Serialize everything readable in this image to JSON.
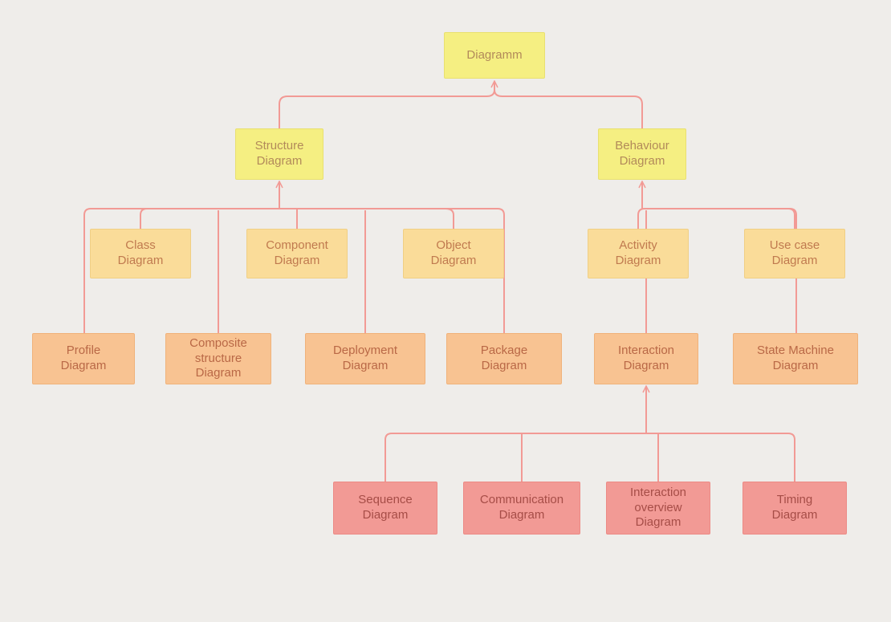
{
  "root": {
    "label": "Diagramm"
  },
  "categories": {
    "structure": {
      "label": "Structure\nDiagram"
    },
    "behaviour": {
      "label": "Behaviour\nDiagram"
    }
  },
  "structure_sub1": {
    "class": {
      "label": "Class\nDiagram"
    },
    "component": {
      "label": "Component\nDiagram"
    },
    "object": {
      "label": "Object\nDiagram"
    }
  },
  "structure_sub2": {
    "profile": {
      "label": "Profile\nDiagram"
    },
    "composite": {
      "label": "Composite\nstructure\nDiagram"
    },
    "deployment": {
      "label": "Deployment\nDiagram"
    },
    "package": {
      "label": "Package\nDiagram"
    }
  },
  "behaviour_sub1": {
    "activity": {
      "label": "Activity\nDiagram"
    },
    "usecase": {
      "label": "Use case\nDiagram"
    }
  },
  "behaviour_sub2": {
    "interaction": {
      "label": "Interaction\nDiagram"
    },
    "statemachine": {
      "label": "State Machine\nDiagram"
    }
  },
  "interaction_leaves": {
    "sequence": {
      "label": "Sequence\nDiagram"
    },
    "communication": {
      "label": "Communication\nDiagram"
    },
    "overview": {
      "label": "Interaction\noverview\nDiagram"
    },
    "timing": {
      "label": "Timing\nDiagram"
    }
  },
  "connector_color": "#f29a95"
}
